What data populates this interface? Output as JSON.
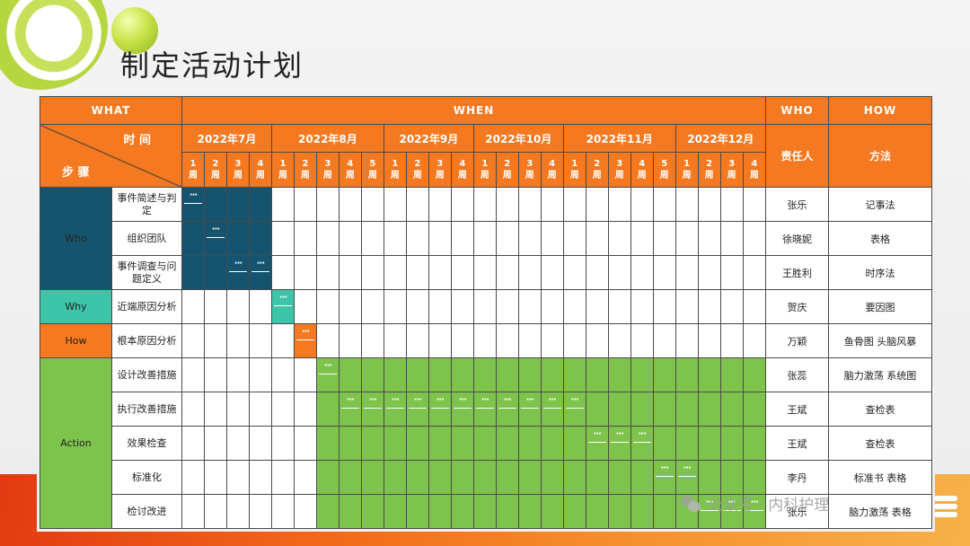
{
  "slide": {
    "title": "制定活动计划",
    "watermark": "公众号 · 内科护理"
  },
  "header": {
    "what": "WHAT",
    "when": "WHEN",
    "who": "WHO",
    "how": "HOW",
    "corner_top": "时 间",
    "corner_bottom": "步 骤",
    "responsible": "责任人",
    "method": "方法",
    "months": [
      {
        "label": "2022年7月",
        "weeks": [
          "1\n周",
          "2\n周",
          "3\n周",
          "4\n周"
        ]
      },
      {
        "label": "2022年8月",
        "weeks": [
          "1\n周",
          "2\n周",
          "3\n周",
          "4\n周",
          "5\n周"
        ]
      },
      {
        "label": "2022年9月",
        "weeks": [
          "1\n周",
          "2\n周",
          "3\n周",
          "4\n周"
        ]
      },
      {
        "label": "2022年10月",
        "weeks": [
          "1\n周",
          "2\n周",
          "3\n周",
          "4\n周"
        ]
      },
      {
        "label": "2022年11月",
        "weeks": [
          "1\n周",
          "2\n周",
          "3\n周",
          "4\n周",
          "5\n周"
        ]
      },
      {
        "label": "2022年12月",
        "weeks": [
          "1\n周",
          "2\n周",
          "3\n周",
          "4\n周"
        ]
      }
    ]
  },
  "groups": [
    {
      "label": "Who",
      "color": "#15536e",
      "rows": 3
    },
    {
      "label": "Why",
      "color": "#3ec4a8",
      "rows": 1
    },
    {
      "label": "How",
      "color": "#f47920",
      "rows": 1
    },
    {
      "label": "Action",
      "color": "#7ec44c",
      "rows": 5
    }
  ],
  "rows": [
    {
      "step": "事件简述与判定",
      "group": "who",
      "fill": [
        0,
        3
      ],
      "marks": [
        0
      ],
      "owner": "张乐",
      "method": "记事法"
    },
    {
      "step": "组织团队",
      "group": "who",
      "fill": [
        0,
        3
      ],
      "marks": [
        1
      ],
      "owner": "徐晓妮",
      "method": "表格"
    },
    {
      "step": "事件调查与问题定义",
      "group": "who",
      "fill": [
        0,
        3
      ],
      "marks": [
        2,
        3
      ],
      "owner": "王胜利",
      "method": "时序法"
    },
    {
      "step": "近端原因分析",
      "group": "why",
      "fill": [
        4,
        4
      ],
      "marks": [
        4
      ],
      "owner": "贺庆",
      "method": "要因图"
    },
    {
      "step": "根本原因分析",
      "group": "how",
      "fill": [
        5,
        5
      ],
      "marks": [
        5
      ],
      "owner": "万颖",
      "method": "鱼骨图 头脑风暴"
    },
    {
      "step": "设计改善措施",
      "group": "act",
      "fill": [
        6,
        25
      ],
      "marks": [
        6
      ],
      "owner": "张蕊",
      "method": "脑力激荡 系统图"
    },
    {
      "step": "执行改善措施",
      "group": "act",
      "fill": [
        6,
        25
      ],
      "marks": [
        7,
        8,
        9,
        10,
        11,
        12,
        13,
        14,
        15,
        16,
        17
      ],
      "owner": "王斌",
      "method": "查检表"
    },
    {
      "step": "效果检查",
      "group": "act",
      "fill": [
        6,
        25
      ],
      "marks": [
        18,
        19,
        20
      ],
      "owner": "王斌",
      "method": "查检表"
    },
    {
      "step": "标准化",
      "group": "act",
      "fill": [
        6,
        25
      ],
      "marks": [
        21,
        22
      ],
      "owner": "李丹",
      "method": "标准书 表格"
    },
    {
      "step": "检讨改进",
      "group": "act",
      "fill": [
        6,
        25
      ],
      "marks": [
        23,
        24,
        25
      ],
      "owner": "张乐",
      "method": "脑力激荡 表格"
    }
  ],
  "mark_text": "···"
}
